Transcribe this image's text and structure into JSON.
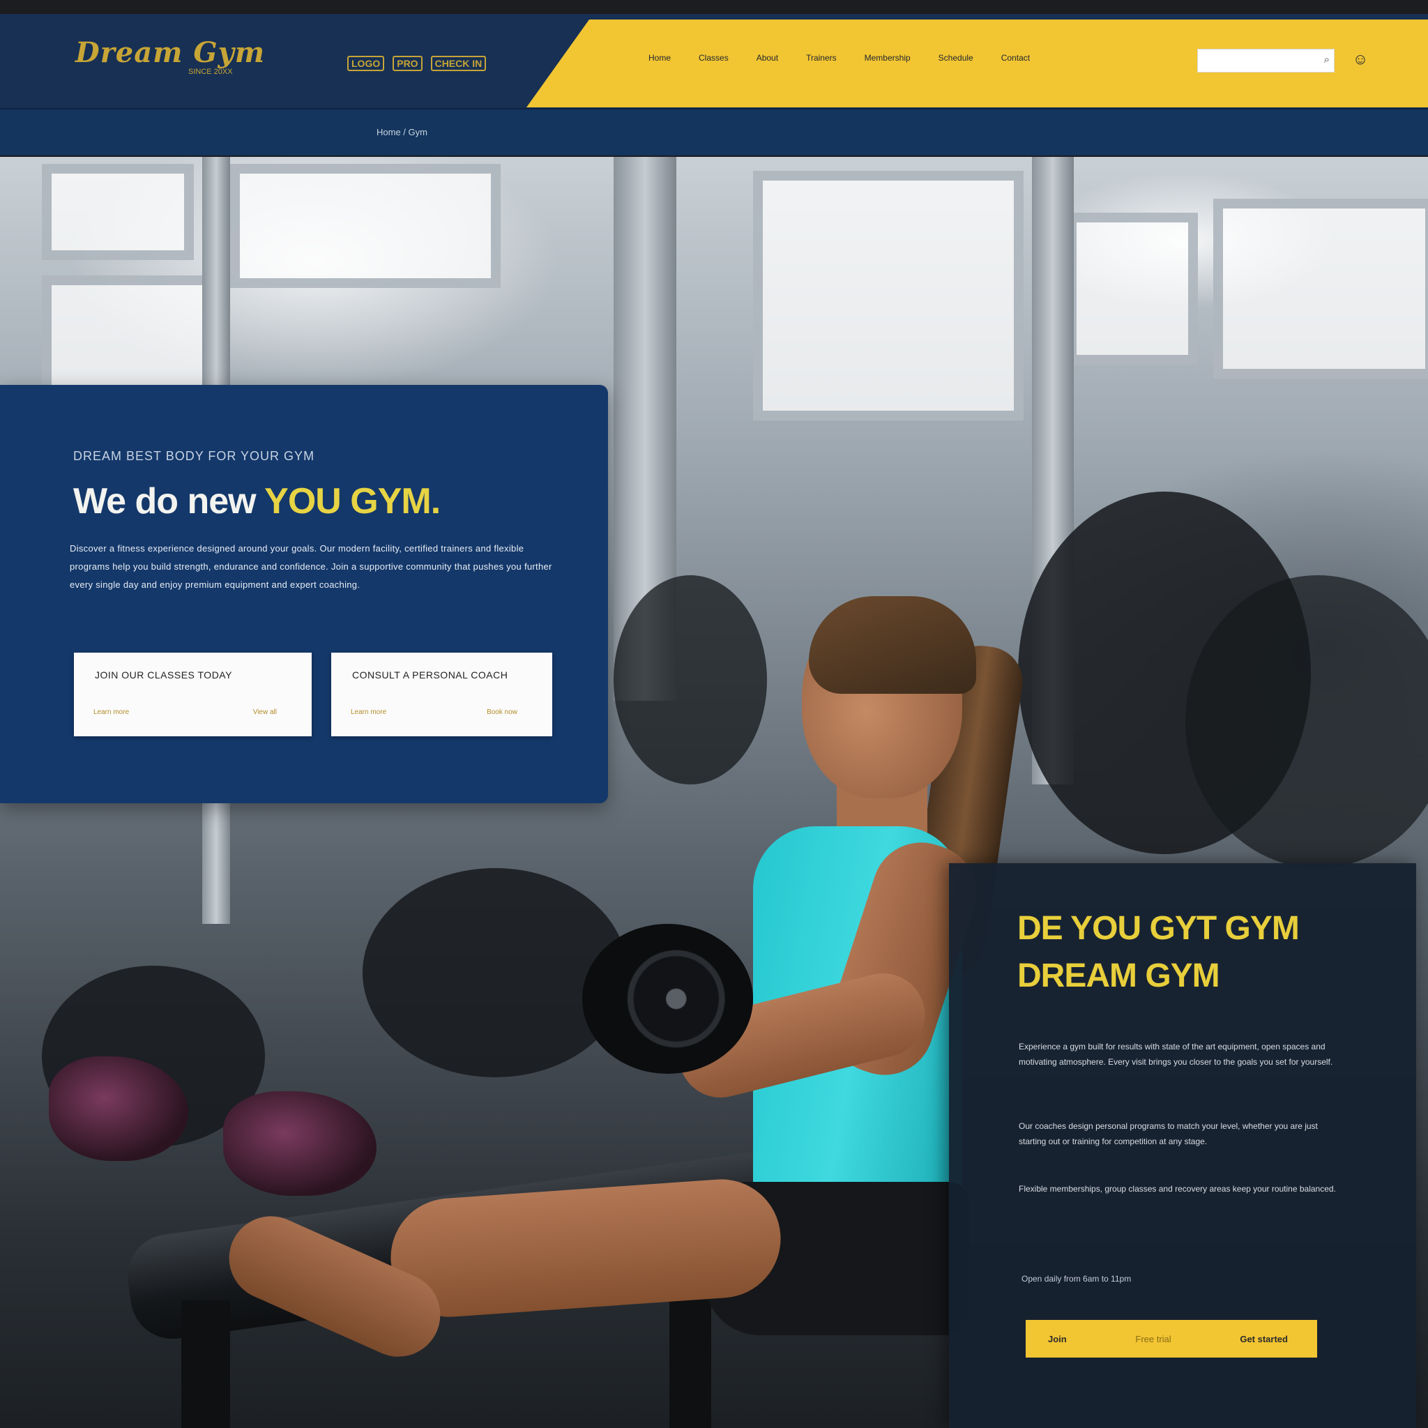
{
  "brand": {
    "logo": "Dream Gym",
    "logo_sub": "SINCE 20XX"
  },
  "top_badges": [
    "LOGO",
    "PRO",
    "CHECK IN"
  ],
  "nav": {
    "items": [
      "Home",
      "Classes",
      "About",
      "Trainers",
      "Membership",
      "Schedule",
      "Contact"
    ],
    "search_placeholder": ""
  },
  "subbar": {
    "text": "Home / Gym"
  },
  "promo": {
    "eyebrow": "DREAM BEST BODY FOR YOUR GYM",
    "headline_white": "We do new",
    "headline_yellow": "YOU GYM.",
    "body": "Discover a fitness experience designed around your goals. Our modern facility, certified trainers and flexible programs help you build strength, endurance and confidence. Join a supportive community that pushes you further every single day and enjoy premium equipment and expert coaching.",
    "cards": [
      {
        "title": "JOIN OUR CLASSES TODAY",
        "link": "Learn more",
        "link_r": "View all"
      },
      {
        "title": "CONSULT A PERSONAL COACH",
        "link": "Learn more",
        "link_r": "Book now"
      }
    ]
  },
  "dream": {
    "title_line1": "DE YOU GYT GYM",
    "title_line2": "DREAM GYM",
    "paragraph1": "Experience a gym built for results with state of the art equipment, open spaces and motivating atmosphere. Every visit brings you closer to the goals you set for yourself.",
    "paragraph2": "Our coaches design personal programs to match your level, whether you are just starting out or training for competition at any stage.",
    "paragraph3": "Flexible memberships, group classes and recovery areas keep your routine balanced.",
    "meta": "Open daily from 6am to 11pm",
    "cta_left": "Join",
    "cta_mid": "Free trial",
    "cta_right": "Get started"
  }
}
